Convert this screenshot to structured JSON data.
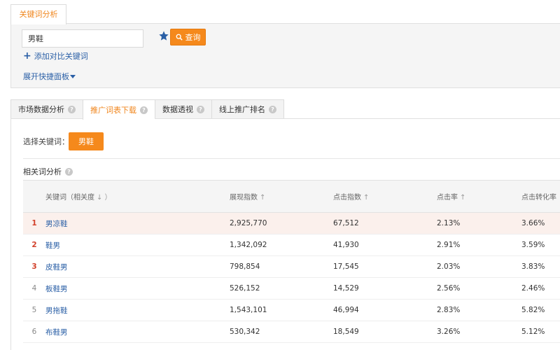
{
  "top_tab": {
    "label": "关键词分析"
  },
  "search": {
    "value": "男鞋",
    "query_label": "查询",
    "add_compare_label": "添加对比关键词",
    "expand_label": "展开快捷面板"
  },
  "section_tabs": [
    {
      "label": "市场数据分析",
      "active": false
    },
    {
      "label": "推广词表下载",
      "active": true
    },
    {
      "label": "数据透视",
      "active": false
    },
    {
      "label": "线上推广排名",
      "active": false
    }
  ],
  "content": {
    "select_label": "选择关键词：",
    "selected_keyword": "男鞋",
    "related_title": "相关词分析"
  },
  "table": {
    "headers": {
      "keyword": "关键词（相关度",
      "impressions": "展现指数",
      "clicks": "点击指数",
      "ctr": "点击率",
      "cvr": "点击转化率"
    },
    "rows": [
      {
        "rank": "1",
        "keyword": "男凉鞋",
        "impressions": "2,925,770",
        "clicks": "67,512",
        "ctr": "2.13%",
        "cvr": "3.66%"
      },
      {
        "rank": "2",
        "keyword": "鞋男",
        "impressions": "1,342,092",
        "clicks": "41,930",
        "ctr": "2.91%",
        "cvr": "3.59%"
      },
      {
        "rank": "3",
        "keyword": "皮鞋男",
        "impressions": "798,854",
        "clicks": "17,545",
        "ctr": "2.03%",
        "cvr": "3.83%"
      },
      {
        "rank": "4",
        "keyword": "板鞋男",
        "impressions": "526,152",
        "clicks": "14,529",
        "ctr": "2.56%",
        "cvr": "2.46%"
      },
      {
        "rank": "5",
        "keyword": "男拖鞋",
        "impressions": "1,543,101",
        "clicks": "46,994",
        "ctr": "2.83%",
        "cvr": "5.82%"
      },
      {
        "rank": "6",
        "keyword": "布鞋男",
        "impressions": "530,342",
        "clicks": "18,549",
        "ctr": "3.26%",
        "cvr": "5.12%"
      }
    ]
  },
  "colors": {
    "accent_orange": "#f5891c",
    "link_blue": "#2a5fa6",
    "rank_red": "#d2402a",
    "highlight_row": "#fbf0ec"
  },
  "icons": {
    "star": "star-icon",
    "search": "search-icon",
    "plus": "plus-icon",
    "help": "help-icon",
    "sort": "sort-arrow-icon"
  }
}
